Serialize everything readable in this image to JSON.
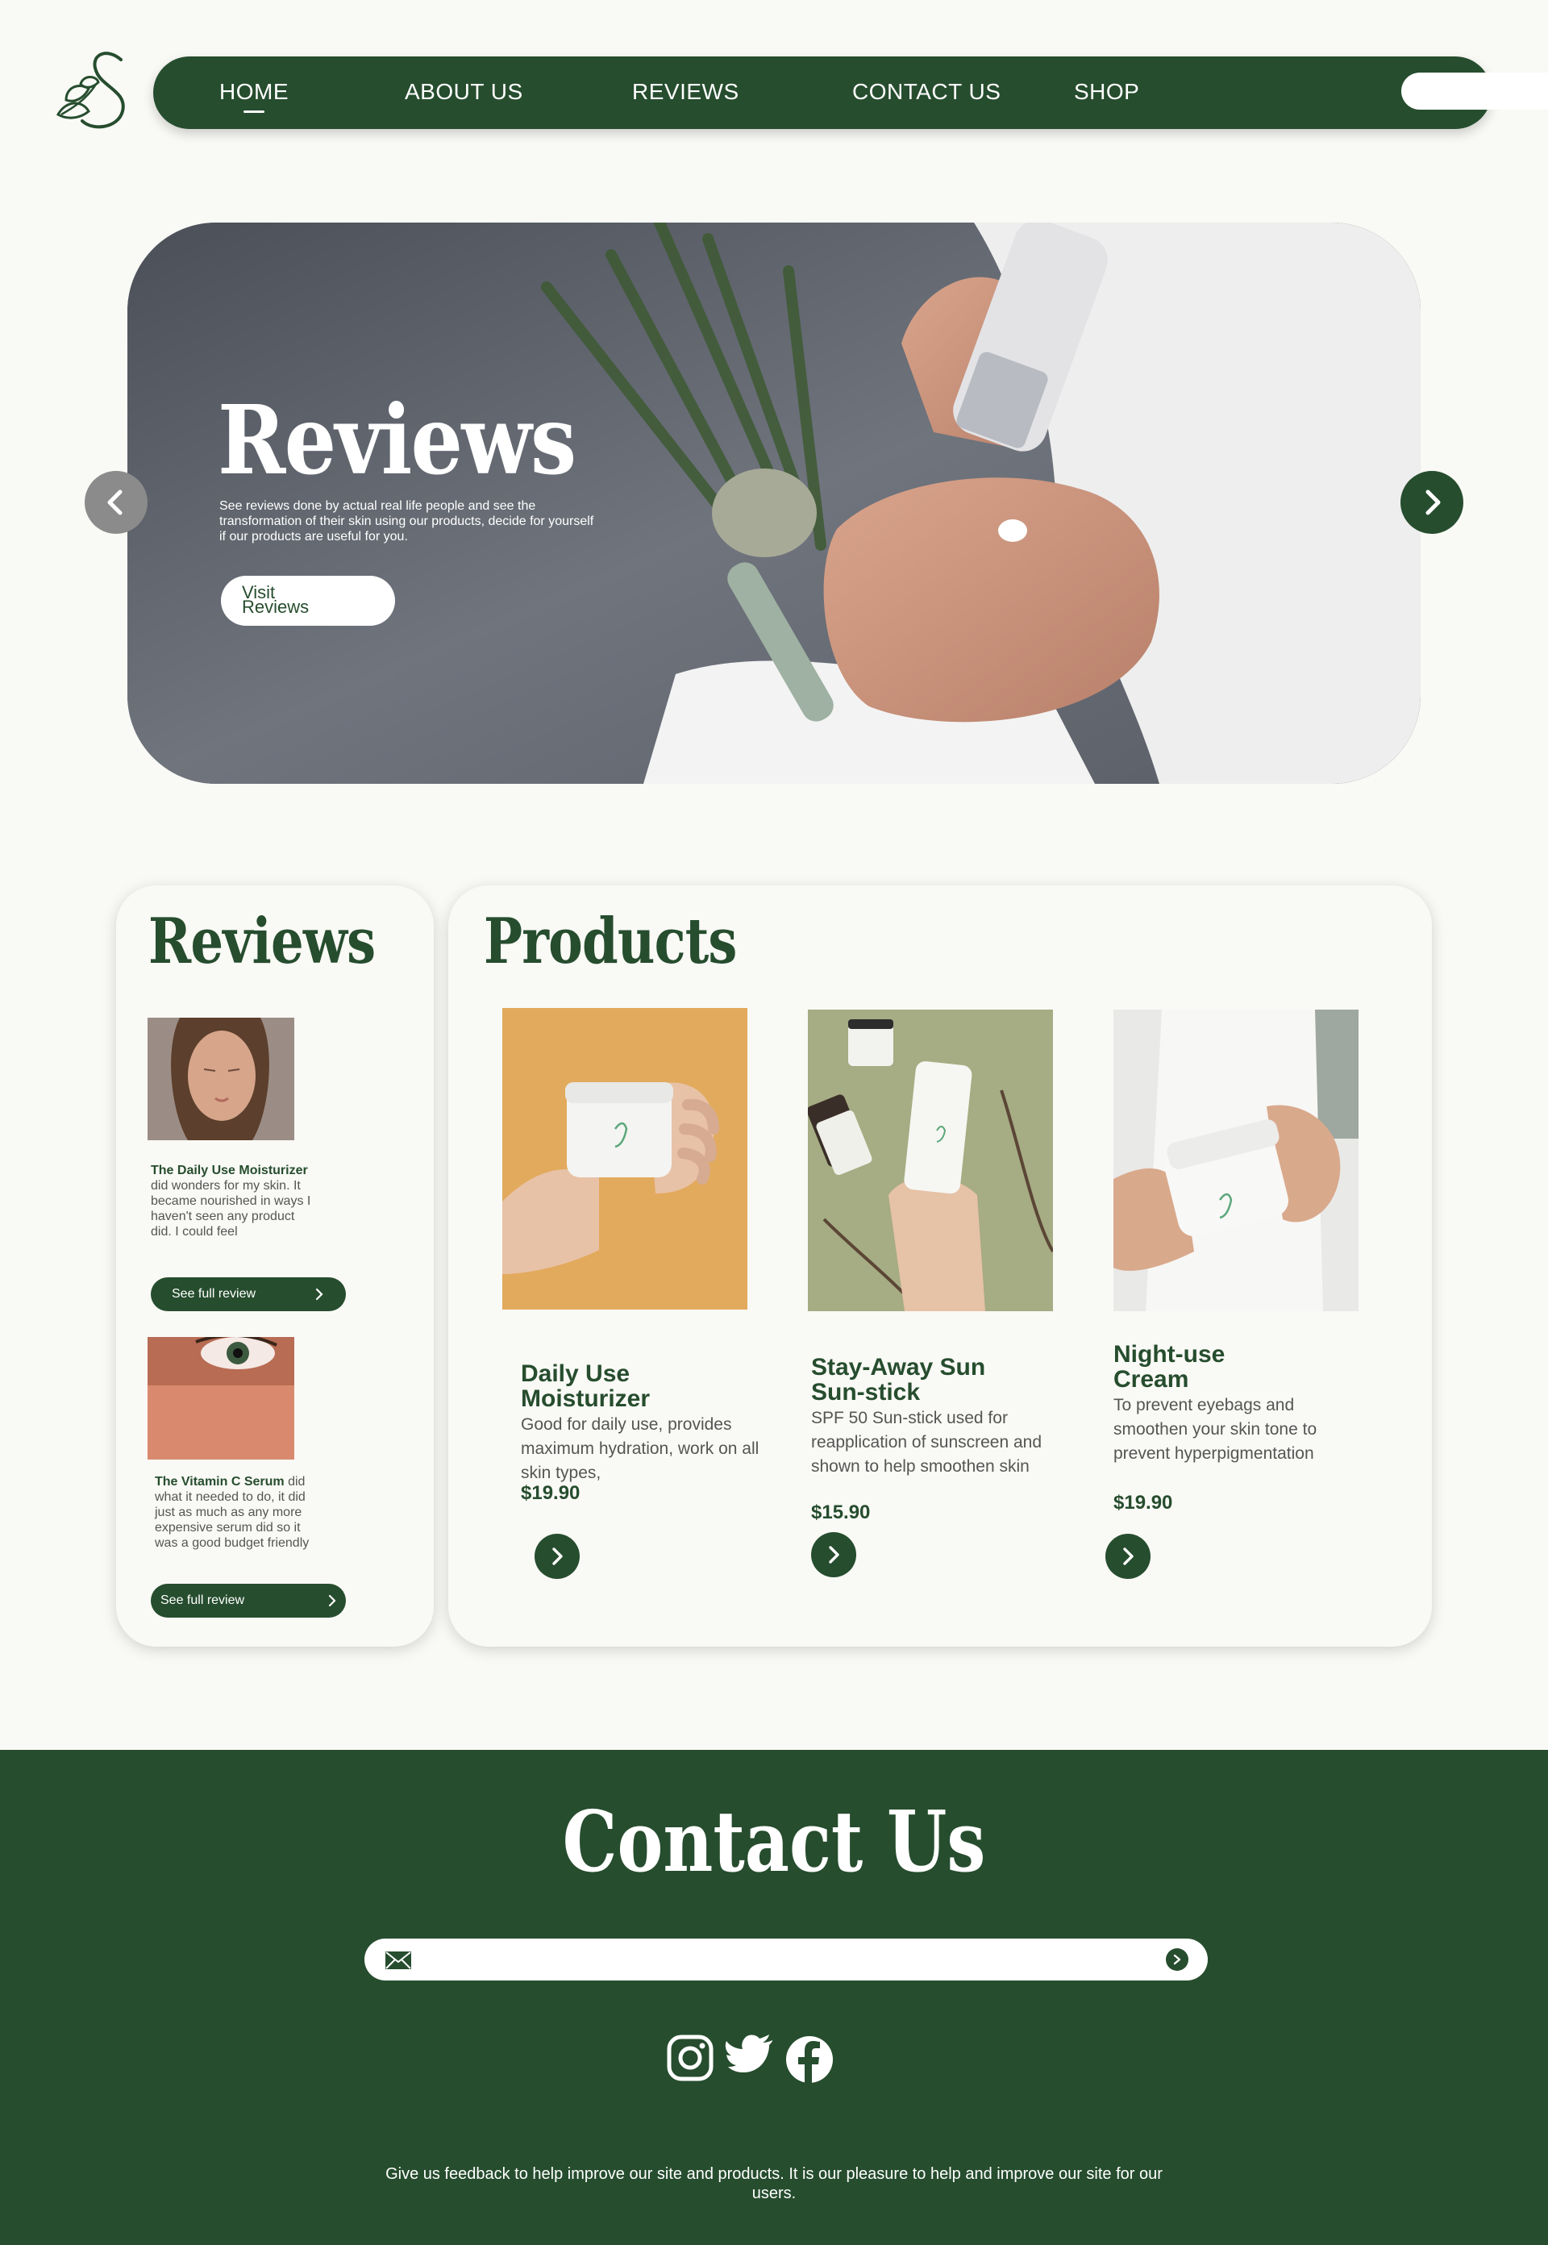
{
  "nav": {
    "items": [
      "HOME",
      "ABOUT US",
      "REVIEWS",
      "CONTACT US",
      "SHOP"
    ],
    "search_placeholder": ""
  },
  "hero": {
    "title": "Reviews",
    "description": "See reviews done by actual real life people and see the transformation of their skin using our products, decide for yourself if our products are useful for you.",
    "button_line1": "Visit",
    "button_line2": "Reviews"
  },
  "reviews": {
    "title": "Reviews",
    "items": [
      {
        "product": "The Daily Use Moisturizer",
        "text": " did wonders for my skin. It became nourished in ways I haven't seen any product did. I could feel",
        "button": "See full review"
      },
      {
        "product": "The Vitamin C Serum",
        "text": " did what it needed to do, it did just as much as any more expensive serum did so it was a good budget friendly",
        "button": "See full review"
      }
    ]
  },
  "products": {
    "title": "Products",
    "items": [
      {
        "name": "Daily Use Moisturizer",
        "desc": "Good for daily use, provides maximum hydration, work on all skin types,",
        "price": "$19.90"
      },
      {
        "name": "Stay-Away Sun Sun-stick",
        "desc": "SPF 50 Sun-stick used for reapplication of sunscreen and shown to help smoothen skin",
        "price": "$15.90"
      },
      {
        "name": "Night-use Cream",
        "desc": "To prevent eyebags and smoothen your skin tone to prevent hyperpigmentation",
        "price": "$19.90"
      }
    ]
  },
  "footer": {
    "title": "Contact Us",
    "email_placeholder": "",
    "feedback": "Give us feedback to help improve our site and products. It is our pleasure to help and improve our site for our users."
  },
  "icons": {
    "logo": "leaf-s-logo",
    "search": "search-icon",
    "prev": "chevron-left-icon",
    "next": "chevron-right-icon",
    "mail": "mail-icon",
    "instagram": "instagram-icon",
    "twitter": "twitter-icon",
    "facebook": "facebook-icon"
  },
  "colors": {
    "brand": "#264d2e",
    "background": "#f9f9f5"
  }
}
